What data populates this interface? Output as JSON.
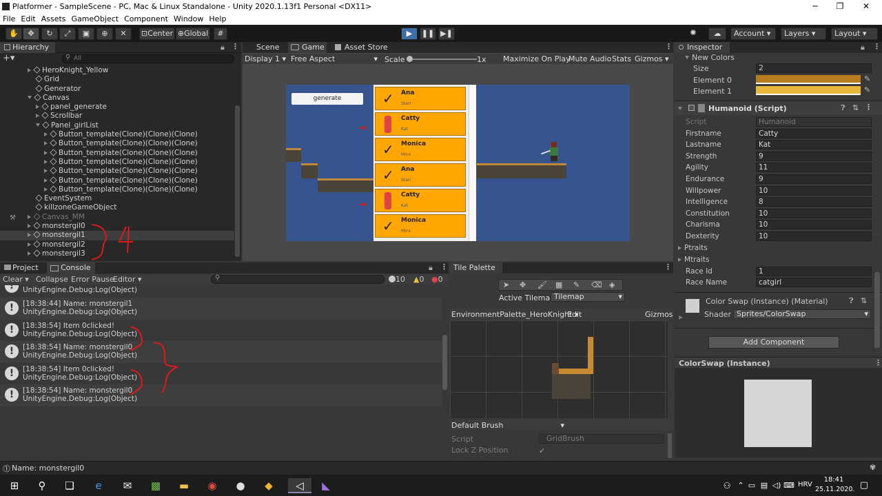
{
  "window": {
    "title": "Platformer - SampleScene - PC, Mac & Linux Standalone - Unity 2020.1.13f1 Personal <DX11>"
  },
  "menu": [
    "File",
    "Edit",
    "Assets",
    "GameObject",
    "Component",
    "Window",
    "Help"
  ],
  "toolbar": {
    "center": "Center",
    "global": "Global",
    "account": "Account",
    "layers": "Layers",
    "layout": "Layout"
  },
  "hierarchy": {
    "tab": "Hierarchy",
    "search_placeholder": "All",
    "items": [
      "HeroKnight_Yellow",
      "Grid",
      "Generator",
      "Canvas",
      "panel_generate",
      "Scrollbar",
      "Panel_girlList",
      "Button_template(Clone)(Clone)(Clone)",
      "Button_template(Clone)(Clone)(Clone)",
      "Button_template(Clone)(Clone)(Clone)",
      "Button_template(Clone)(Clone)(Clone)",
      "Button_template(Clone)(Clone)(Clone)",
      "Button_template(Clone)(Clone)(Clone)",
      "Button_template(Clone)(Clone)(Clone)",
      "EventSystem",
      "killzoneGameObject",
      "Canvas_MM",
      "monstergil0",
      "monstergil1",
      "monstergil2",
      "monstergil3"
    ],
    "annotation": "4"
  },
  "scene": {
    "tabs": [
      "Scene",
      "Game",
      "Asset Store"
    ],
    "display": "Display 1",
    "aspect": "Free Aspect",
    "scale_label": "Scale",
    "scale_value": "1x",
    "opts": [
      "Maximize On Play",
      "Mute Audio",
      "Stats",
      "Gizmos"
    ],
    "generate": "generate",
    "cards": [
      {
        "name": "Ana",
        "sub": "Starr",
        "icon": "check"
      },
      {
        "name": "Catty",
        "sub": "Kat",
        "icon": "cat"
      },
      {
        "name": "Monica",
        "sub": "Minx",
        "icon": "check"
      },
      {
        "name": "Ana",
        "sub": "Starr",
        "icon": "check"
      },
      {
        "name": "Catty",
        "sub": "Kat",
        "icon": "cat"
      },
      {
        "name": "Monica",
        "sub": "Minx",
        "icon": "check"
      }
    ]
  },
  "console": {
    "tabs": [
      "Project",
      "Console"
    ],
    "buttons": [
      "Clear",
      "Collapse",
      "Error Pause",
      "Editor"
    ],
    "counts": [
      "10",
      "0",
      "0"
    ],
    "entries": [
      {
        "l1": "",
        "l2": "UnityEngine.Debug:Log(Object)"
      },
      {
        "l1": "[18:38:44] Name: monstergil1",
        "l2": "UnityEngine.Debug:Log(Object)"
      },
      {
        "l1": "[18:38:54] Item 0clicked!",
        "l2": "UnityEngine.Debug:Log(Object)"
      },
      {
        "l1": "[18:38:54] Name: monstergil0",
        "l2": "UnityEngine.Debug:Log(Object)"
      },
      {
        "l1": "[18:38:54] Item 0clicked!",
        "l2": "UnityEngine.Debug:Log(Object)"
      },
      {
        "l1": "[18:38:54] Name: monstergil0",
        "l2": "UnityEngine.Debug:Log(Object)"
      }
    ]
  },
  "tilepalette": {
    "tab": "Tile Palette",
    "active_label": "Active Tilemap",
    "active_value": "Tilemap",
    "palette": "EnvironmentPalette_HeroKnight",
    "edit": "Edit",
    "gizmos": "Gizmos",
    "brush": "Default Brush",
    "script_label": "Script",
    "script_value": "GridBrush",
    "lockz": "Lock Z Position"
  },
  "inspector": {
    "tab": "Inspector",
    "new_colors": "New Colors",
    "size_label": "Size",
    "size_value": "2",
    "el0": "Element 0",
    "el1": "Element 1",
    "color0": "#b87d1f",
    "color1": "#e8b73a",
    "component": "Humanoid (Script)",
    "fields": [
      {
        "k": "Script",
        "v": "Humanoid"
      },
      {
        "k": "Firstname",
        "v": "Catty"
      },
      {
        "k": "Lastname",
        "v": "Kat"
      },
      {
        "k": "Strength",
        "v": "9"
      },
      {
        "k": "Agility",
        "v": "11"
      },
      {
        "k": "Endurance",
        "v": "9"
      },
      {
        "k": "Willpower",
        "v": "10"
      },
      {
        "k": "Intelligence",
        "v": "8"
      },
      {
        "k": "Constitution",
        "v": "10"
      },
      {
        "k": "Charisma",
        "v": "10"
      },
      {
        "k": "Dexterity",
        "v": "10"
      }
    ],
    "ptraits": "Ptraits",
    "mtraits": "Mtraits",
    "race_id_label": "Race Id",
    "race_id": "1",
    "race_name_label": "Race Name",
    "race_name": "catgirl",
    "material": "Color Swap (Instance) (Material)",
    "shader_label": "Shader",
    "shader": "Sprites/ColorSwap",
    "add_component": "Add Component",
    "preview": "ColorSwap (Instance)"
  },
  "status": {
    "text": "Name: monstergil0"
  },
  "taskbar": {
    "lang": "HRV",
    "time": "18:41",
    "date": "25.11.2020."
  }
}
